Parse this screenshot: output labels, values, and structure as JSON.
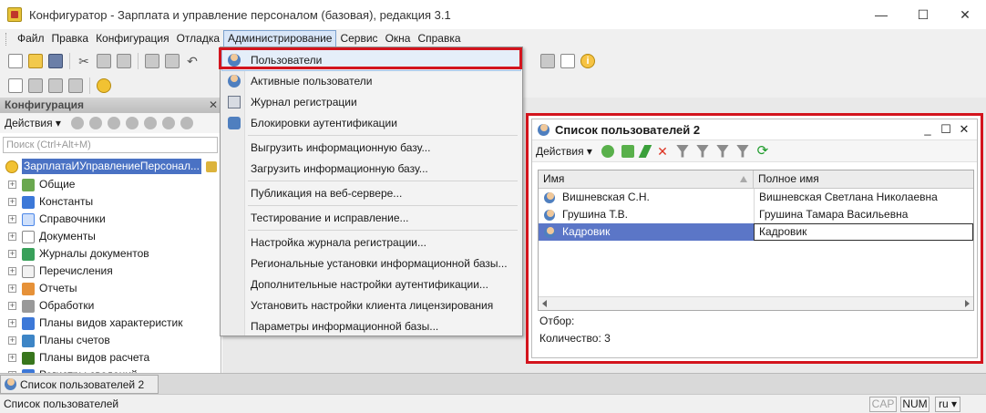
{
  "window": {
    "title": "Конфигуратор - Зарплата и управление персоналом (базовая), редакция 3.1",
    "minimize": "—",
    "maximize": "☐",
    "close": "✕"
  },
  "menubar": {
    "items": [
      {
        "label": "Файл",
        "underline": "Ф"
      },
      {
        "label": "Правка"
      },
      {
        "label": "Конфигурация"
      },
      {
        "label": "Отладка"
      },
      {
        "label": "Администрирование",
        "active": true
      },
      {
        "label": "Сервис"
      },
      {
        "label": "Окна"
      },
      {
        "label": "Справка"
      }
    ]
  },
  "config_panel": {
    "title": "Конфигурация",
    "close": "✕",
    "actions_label": "Действия ▾",
    "search_placeholder": "Поиск (Ctrl+Alt+M)",
    "root_label": "ЗарплатаИУправлениеПерсонал...",
    "items": [
      {
        "label": "Общие",
        "color": "#6aa84f"
      },
      {
        "label": "Константы",
        "color": "#3c78d8"
      },
      {
        "label": "Справочники",
        "color": "#4a86e8"
      },
      {
        "label": "Документы",
        "color": "#ffffff"
      },
      {
        "label": "Журналы документов",
        "color": "#38a05a"
      },
      {
        "label": "Перечисления",
        "color": "#e0e0e0"
      },
      {
        "label": "Отчеты",
        "color": "#e69138"
      },
      {
        "label": "Обработки",
        "color": "#999999"
      },
      {
        "label": "Планы видов характеристик",
        "color": "#3c78d8"
      },
      {
        "label": "Планы счетов",
        "color": "#3d85c6"
      },
      {
        "label": "Планы видов расчета",
        "color": "#38761d"
      },
      {
        "label": "Регистры сведений",
        "color": "#3c78d8"
      }
    ]
  },
  "admin_menu": {
    "items": [
      {
        "label": "Пользователи",
        "icon": "user-icon",
        "selected": true
      },
      {
        "label": "Активные пользователи",
        "icon": "active-users-icon"
      },
      {
        "label": "Журнал регистрации",
        "icon": "log-icon"
      },
      {
        "label": "Блокировки аутентификации",
        "icon": "lock-user-icon"
      },
      {
        "label": "Выгрузить информационную базу..."
      },
      {
        "label": "Загрузить информационную базу..."
      },
      {
        "label": "Публикация на веб-сервере..."
      },
      {
        "label": "Тестирование и исправление..."
      },
      {
        "label": "Настройка журнала регистрации..."
      },
      {
        "label": "Региональные установки информационной базы..."
      },
      {
        "label": "Дополнительные настройки аутентификации..."
      },
      {
        "label": "Установить настройки клиента лицензирования"
      },
      {
        "label": "Параметры информационной базы..."
      }
    ]
  },
  "users_window": {
    "title": "Список пользователей 2",
    "actions_label": "Действия ▾",
    "columns": [
      "Имя",
      "Полное имя"
    ],
    "rows": [
      {
        "name": "Вишневская С.Н.",
        "full_name": "Вишневская Светлана Николаевна"
      },
      {
        "name": "Грушина Т.В.",
        "full_name": "Грушина Тамара Васильевна"
      },
      {
        "name": "Кадровик",
        "full_name": "Кадровик",
        "selected": true
      }
    ],
    "filter_label": "Отбор:",
    "count_label": "Количество: 3",
    "win_minimize": "_",
    "win_maximize": "☐",
    "win_close": "✕"
  },
  "taskbar": {
    "task_label": "Список пользователей 2"
  },
  "statusbar": {
    "text": "Список пользователей",
    "cap": "CAP",
    "num": "NUM",
    "lang": "ru ▾"
  }
}
